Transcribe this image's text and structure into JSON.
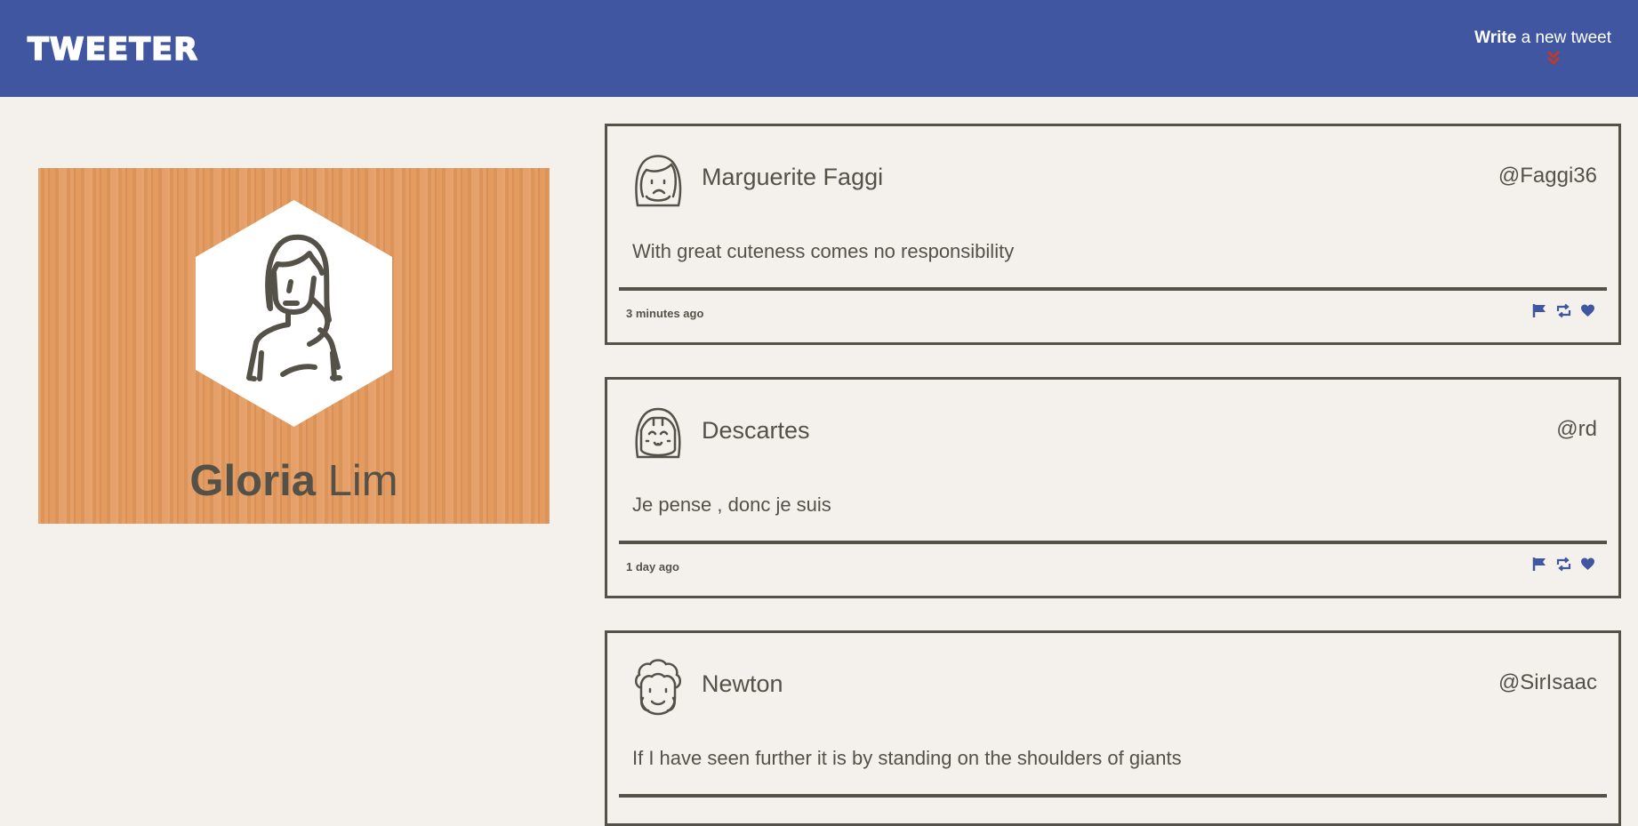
{
  "nav": {
    "logo": "TWEETER",
    "compose_bold": "Write",
    "compose_rest": "a new tweet",
    "compose_icon": "double-chevron-down-icon",
    "compose_icon_color": "#c0392b"
  },
  "profile": {
    "first_name": "Gloria",
    "last_name": "Lim",
    "avatar_icon": "woman-avatar-icon"
  },
  "tweets": [
    {
      "name": "Marguerite Faggi",
      "handle": "@Faggi36",
      "text": "With great cuteness comes no responsibility",
      "time": "3 minutes ago",
      "avatar_icon": "frowning-girl-avatar-icon"
    },
    {
      "name": "Descartes",
      "handle": "@rd",
      "text": "Je pense , donc je suis",
      "time": "1 day ago",
      "avatar_icon": "smiling-girl-avatar-icon"
    },
    {
      "name": "Newton",
      "handle": "@SirIsaac",
      "text": "If I have seen further it is by standing on the shoulders of giants",
      "time": "",
      "avatar_icon": "curly-hair-avatar-icon"
    }
  ],
  "colors": {
    "nav_bg": "#4056a1",
    "page_bg": "#f4f1ec",
    "text": "#545149",
    "accent_icons": "#4056a1",
    "profile_bg": "#e3995c"
  },
  "action_icons": [
    "flag-icon",
    "retweet-icon",
    "heart-icon"
  ]
}
